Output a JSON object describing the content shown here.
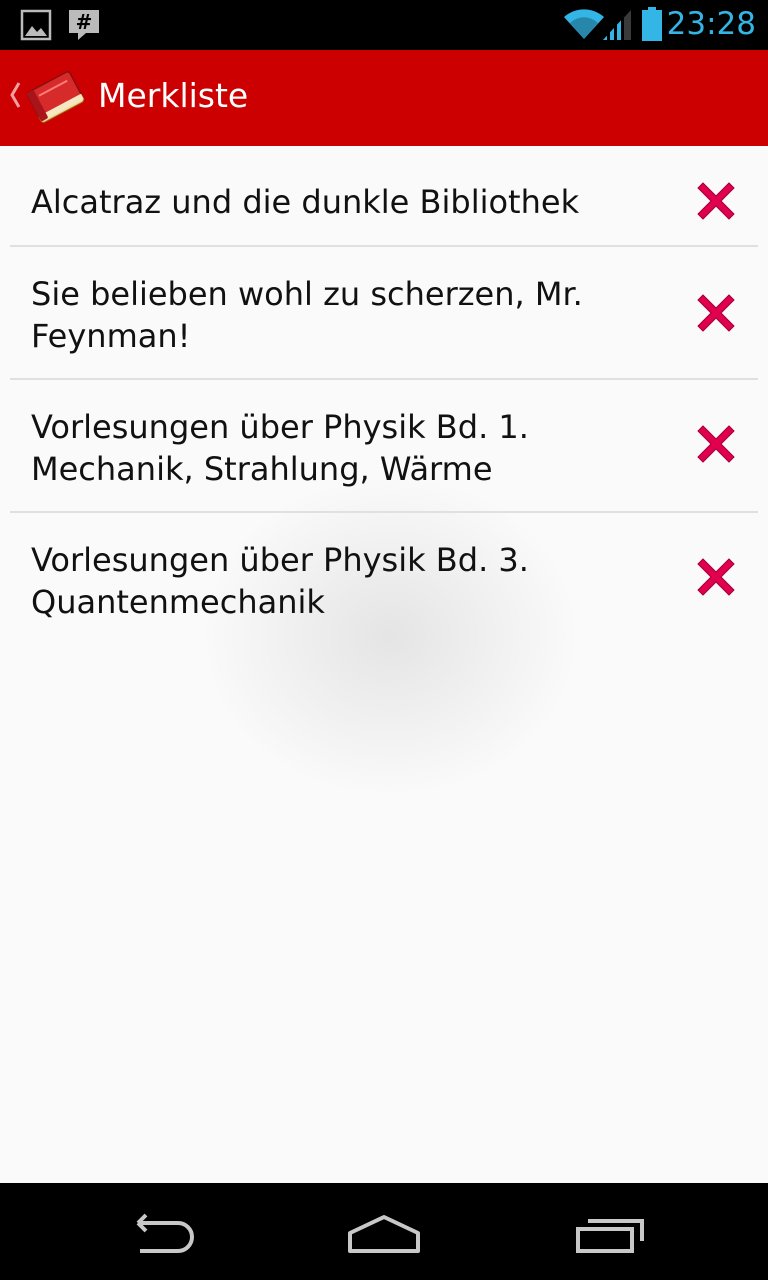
{
  "status_bar": {
    "time": "23:28",
    "notification_icons": [
      "image-icon",
      "hashtag-message-icon"
    ],
    "system_icons": [
      "wifi-icon",
      "signal-icon",
      "battery-icon"
    ],
    "accent_color": "#33b5e5"
  },
  "action_bar": {
    "title": "Merkliste",
    "background_color": "#cc0000",
    "up_icon": "chevron-left-icon",
    "logo_icon": "book-icon"
  },
  "list": {
    "items": [
      {
        "title": "Alcatraz und die dunkle Bibliothek"
      },
      {
        "title": "Sie belieben wohl zu scherzen, Mr. Feynman!"
      },
      {
        "title": "Vorlesungen über Physik Bd. 1. Mechanik, Strahlung, Wärme"
      },
      {
        "title": "Vorlesungen über Physik Bd. 3. Quantenmechanik"
      }
    ],
    "delete_icon": "close-icon",
    "delete_color": "#e0004d"
  },
  "nav_bar": {
    "buttons": [
      "back-icon",
      "home-icon",
      "recent-apps-icon"
    ]
  }
}
